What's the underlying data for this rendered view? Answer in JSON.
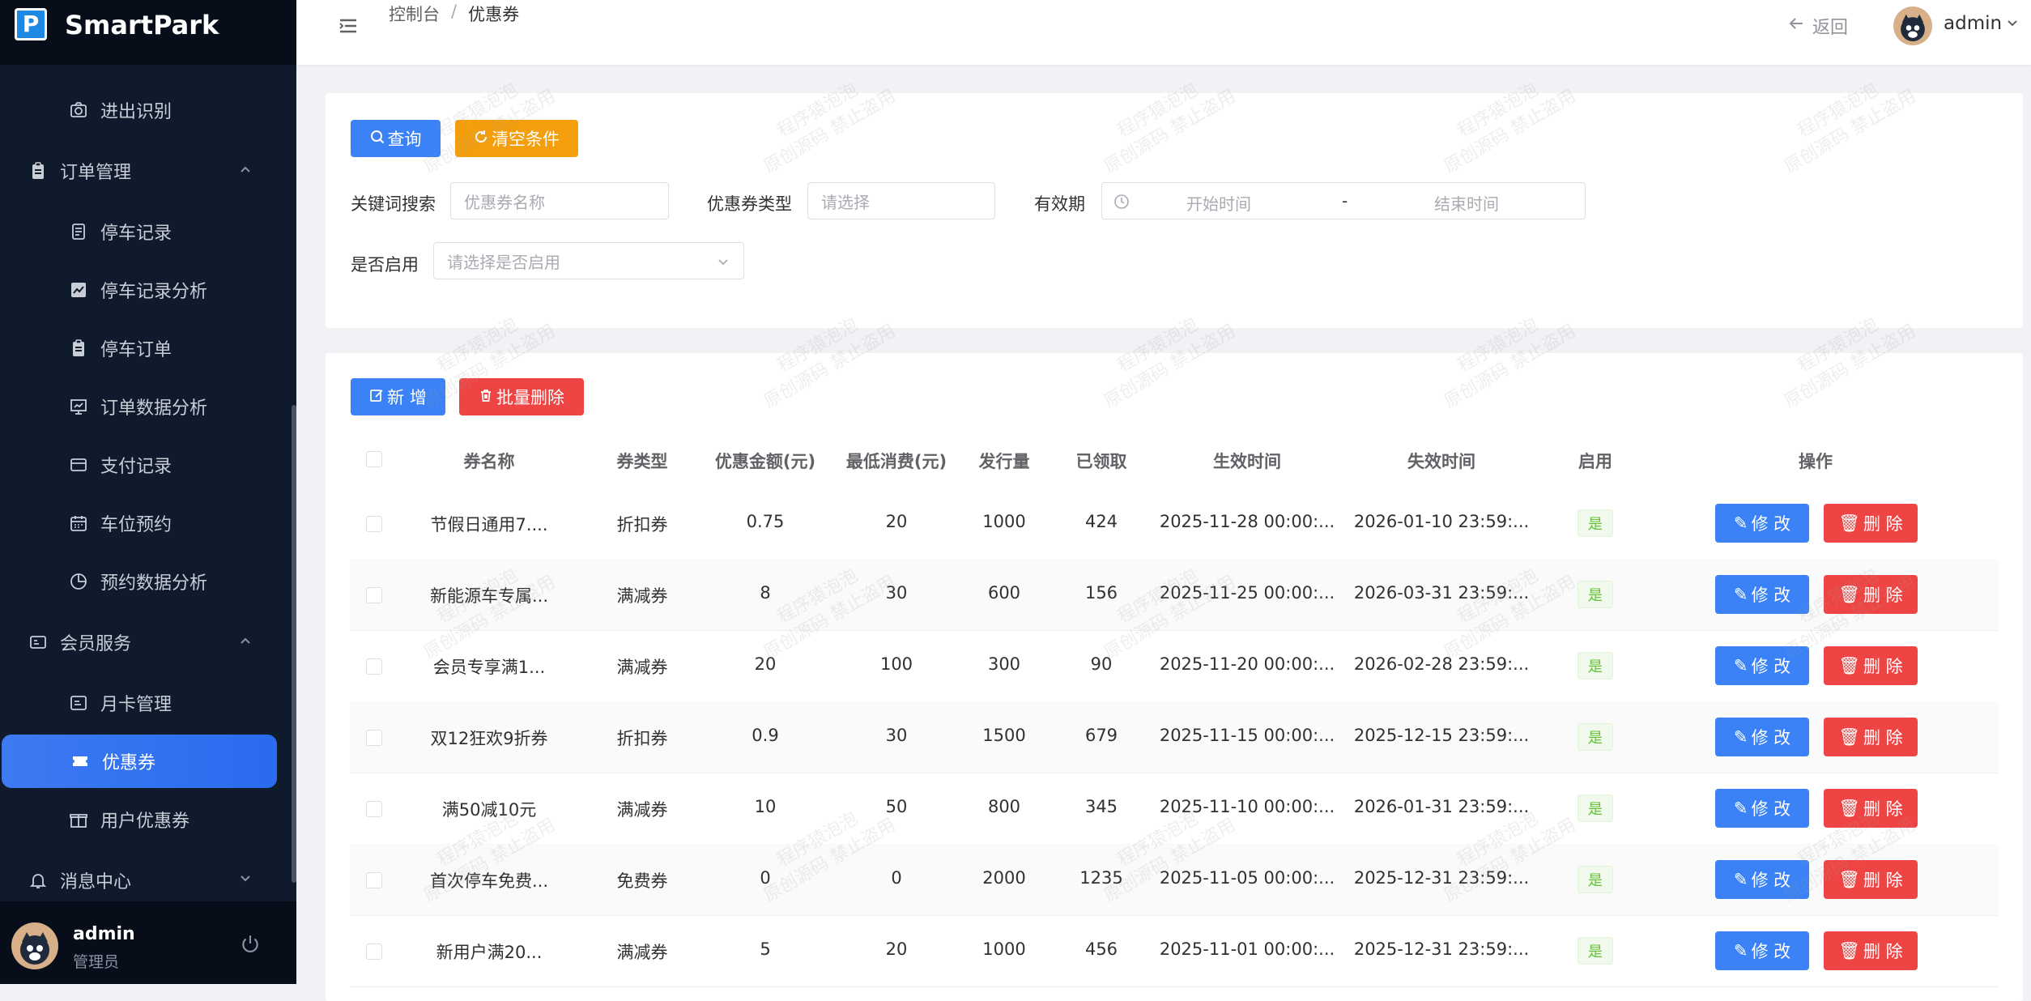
{
  "app": {
    "name": "SmartPark"
  },
  "sidebar": {
    "items": [
      {
        "label": "进出识别",
        "icon": "camera-icon",
        "kind": "sub"
      },
      {
        "label": "订单管理",
        "icon": "clipboard-icon",
        "kind": "group",
        "expanded": true
      },
      {
        "label": "停车记录",
        "icon": "document-icon",
        "kind": "sub"
      },
      {
        "label": "停车记录分析",
        "icon": "line-chart-icon",
        "kind": "sub"
      },
      {
        "label": "停车订单",
        "icon": "clipboard-icon",
        "kind": "sub"
      },
      {
        "label": "订单数据分析",
        "icon": "presentation-chart-icon",
        "kind": "sub"
      },
      {
        "label": "支付记录",
        "icon": "credit-card-icon",
        "kind": "sub"
      },
      {
        "label": "车位预约",
        "icon": "calendar-icon",
        "kind": "sub"
      },
      {
        "label": "预约数据分析",
        "icon": "pie-chart-icon",
        "kind": "sub"
      },
      {
        "label": "会员服务",
        "icon": "member-card-icon",
        "kind": "group",
        "expanded": true
      },
      {
        "label": "月卡管理",
        "icon": "calendar-card-icon",
        "kind": "sub"
      },
      {
        "label": "优惠券",
        "icon": "ticket-icon",
        "kind": "sub",
        "active": true
      },
      {
        "label": "用户优惠券",
        "icon": "gift-icon",
        "kind": "sub"
      },
      {
        "label": "消息中心",
        "icon": "bell-icon",
        "kind": "group",
        "expanded": false
      }
    ],
    "user": {
      "name": "admin",
      "role": "管理员"
    }
  },
  "header": {
    "breadcrumb": [
      "控制台",
      "优惠券"
    ],
    "back_label": "返回",
    "user_name": "admin"
  },
  "filters": {
    "search_label": "查询",
    "reset_label": "清空条件",
    "keyword": {
      "label": "关键词搜索",
      "placeholder": "优惠券名称"
    },
    "type": {
      "label": "优惠券类型",
      "placeholder": "请选择"
    },
    "validity": {
      "label": "有效期",
      "start_placeholder": "开始时间",
      "separator": "-",
      "end_placeholder": "结束时间"
    },
    "enabled": {
      "label": "是否启用",
      "placeholder": "请选择是否启用"
    }
  },
  "toolbar": {
    "add_label": "新 增",
    "batch_delete_label": "批量删除"
  },
  "table": {
    "columns": [
      "券名称",
      "券类型",
      "优惠金额(元)",
      "最低消费(元)",
      "发行量",
      "已领取",
      "生效时间",
      "失效时间",
      "启用",
      "操作"
    ],
    "edit_label": "修 改",
    "delete_label": "删 除",
    "rows": [
      {
        "name": "节假日通用7....",
        "type": "折扣券",
        "amount": "0.75",
        "min": "20",
        "issued": "1000",
        "claimed": "424",
        "start": "2025-11-28 00:00:...",
        "end": "2026-01-10 23:59:...",
        "enabled": "是"
      },
      {
        "name": "新能源车专属...",
        "type": "满减券",
        "amount": "8",
        "min": "30",
        "issued": "600",
        "claimed": "156",
        "start": "2025-11-25 00:00:...",
        "end": "2026-03-31 23:59:...",
        "enabled": "是"
      },
      {
        "name": "会员专享满1...",
        "type": "满减券",
        "amount": "20",
        "min": "100",
        "issued": "300",
        "claimed": "90",
        "start": "2025-11-20 00:00:...",
        "end": "2026-02-28 23:59:...",
        "enabled": "是"
      },
      {
        "name": "双12狂欢9折券",
        "type": "折扣券",
        "amount": "0.9",
        "min": "30",
        "issued": "1500",
        "claimed": "679",
        "start": "2025-11-15 00:00:...",
        "end": "2025-12-15 23:59:...",
        "enabled": "是"
      },
      {
        "name": "满50减10元",
        "type": "满减券",
        "amount": "10",
        "min": "50",
        "issued": "800",
        "claimed": "345",
        "start": "2025-11-10 00:00:...",
        "end": "2026-01-31 23:59:...",
        "enabled": "是"
      },
      {
        "name": "首次停车免费...",
        "type": "免费券",
        "amount": "0",
        "min": "0",
        "issued": "2000",
        "claimed": "1235",
        "start": "2025-11-05 00:00:...",
        "end": "2025-12-31 23:59:...",
        "enabled": "是"
      },
      {
        "name": "新用户满20...",
        "type": "满减券",
        "amount": "5",
        "min": "20",
        "issued": "1000",
        "claimed": "456",
        "start": "2025-11-01 00:00:...",
        "end": "2025-12-31 23:59:...",
        "enabled": "是"
      }
    ]
  },
  "watermark": {
    "line1": "程序猿泡泡",
    "line2": "原创源码 禁止盗用"
  },
  "colors": {
    "primary": "#3b82f6",
    "warning": "#f59e0b",
    "danger": "#ef4444",
    "sidebar": "#0f1b2d",
    "success": "#67c23a"
  }
}
